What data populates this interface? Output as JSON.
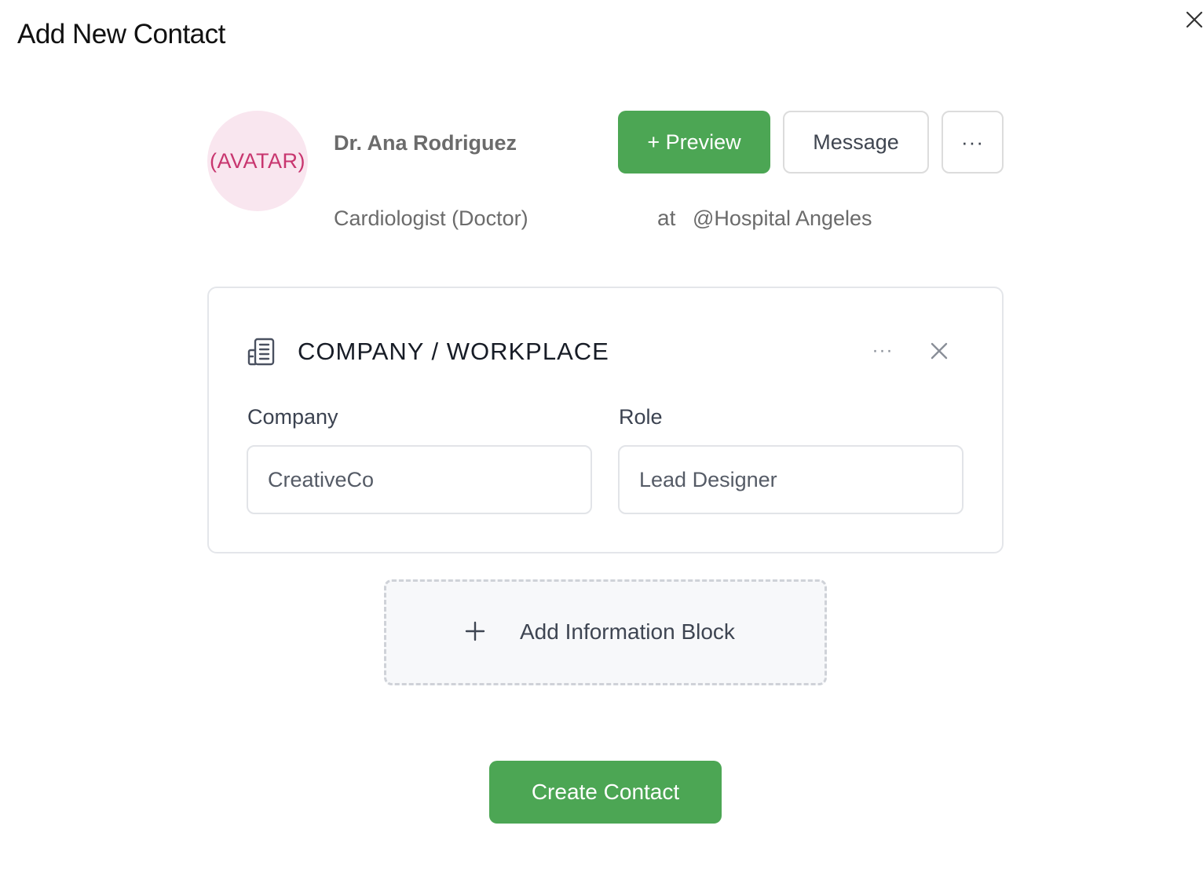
{
  "dialog": {
    "title": "Add New Contact",
    "close_icon": "close-icon"
  },
  "profile": {
    "avatar_text": "(AVATAR)",
    "name": "Dr. Ana Rodriguez",
    "occupation": "Cardiologist (Doctor)",
    "at_word": "at",
    "workplace": "@Hospital Angeles"
  },
  "actions": {
    "preview_label": "+ Preview",
    "message_label": "Message",
    "more_label": "···"
  },
  "card": {
    "icon": "building-icon",
    "title": "COMPANY / WORKPLACE",
    "more_label": "···",
    "close_icon": "close-icon",
    "fields": {
      "company_label": "Company",
      "company_value": "CreativeCo",
      "role_label": "Role",
      "role_value": "Lead Designer"
    }
  },
  "add_block": {
    "icon": "plus-icon",
    "label": "Add Information Block"
  },
  "footer": {
    "create_label": "Create Contact"
  },
  "colors": {
    "primary_green": "#4ca654",
    "avatar_bg": "#f9e6ef",
    "avatar_text": "#c8366f"
  }
}
